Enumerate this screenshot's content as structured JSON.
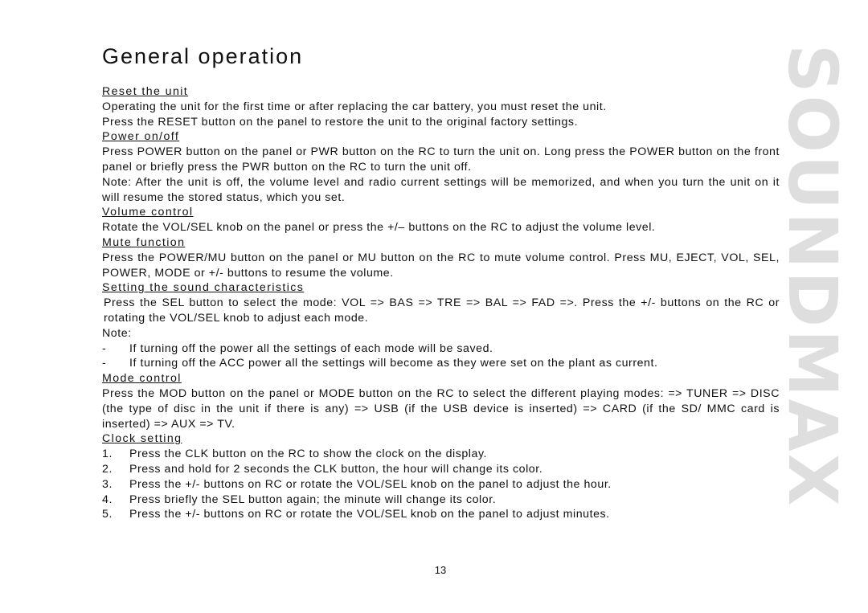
{
  "page": {
    "title": "General operation",
    "page_number": "13",
    "logo_text": "SOUNDMAX",
    "logo_color": "#dedede"
  },
  "sections": {
    "reset": {
      "heading": "Reset the unit",
      "lines": [
        "Operating the unit for the first time or after replacing the car battery, you must reset the unit.",
        "Press the RESET button on the panel to restore the unit to the original factory settings."
      ]
    },
    "power": {
      "heading": "Power on/off",
      "para1": "Press POWER button on the panel or PWR button on the RC to turn the unit on. Long press the POWER button on the front panel or briefly press the PWR button on the RC to turn the unit off.",
      "para2": "Note: After the unit is off, the volume level and radio current settings will be memorized, and when you turn the unit on it will resume the stored status, which you set."
    },
    "volume": {
      "heading": "Volume control",
      "para": "Rotate the VOL/SEL knob on the panel or press the +/– buttons on the RC to adjust the volume level."
    },
    "mute": {
      "heading": "Mute function",
      "para": "Press the POWER/MU button on the panel or MU button on the RC to mute volume control. Press MU, EJECT, VOL, SEL, POWER, MODE or +/- buttons to resume the volume."
    },
    "sound": {
      "heading": "Setting the sound characteristics",
      "para": "Press the SEL button to select the mode: VOL => BAS => TRE => BAL => FAD =>. Press the +/- buttons on the RC or rotating the VOL/SEL knob to adjust each mode.",
      "note_label": "Note:",
      "bullet_mark": "-",
      "bullets": [
        "If turning off the power all the settings of each mode will be saved.",
        "If turning off the ACC power all the settings will become as they were set on the plant as current."
      ]
    },
    "mode": {
      "heading": "Mode control",
      "para": "Press the MOD button on the panel or MODE button on the RC to select the different playing modes: => TUNER => DISC (the type of disc in the unit if there is any) => USB (if the USB device is inserted) => CARD (if the SD/ MMC card is inserted) => AUX => TV."
    },
    "clock": {
      "heading": "Clock setting",
      "steps": [
        {
          "num": "1.",
          "text": "Press the CLK button on the RC to show the clock on the display."
        },
        {
          "num": "2.",
          "text": "Press and hold for 2 seconds the CLK button, the hour will change its color."
        },
        {
          "num": "3.",
          "text": "Press the +/- buttons on RC or rotate the VOL/SEL knob on the panel to adjust the hour."
        },
        {
          "num": "4.",
          "text": "Press briefly the SEL button again; the minute will change its color."
        },
        {
          "num": "5.",
          "text": "Press the +/- buttons on RC or rotate the VOL/SEL knob on the panel to adjust minutes."
        }
      ]
    }
  }
}
